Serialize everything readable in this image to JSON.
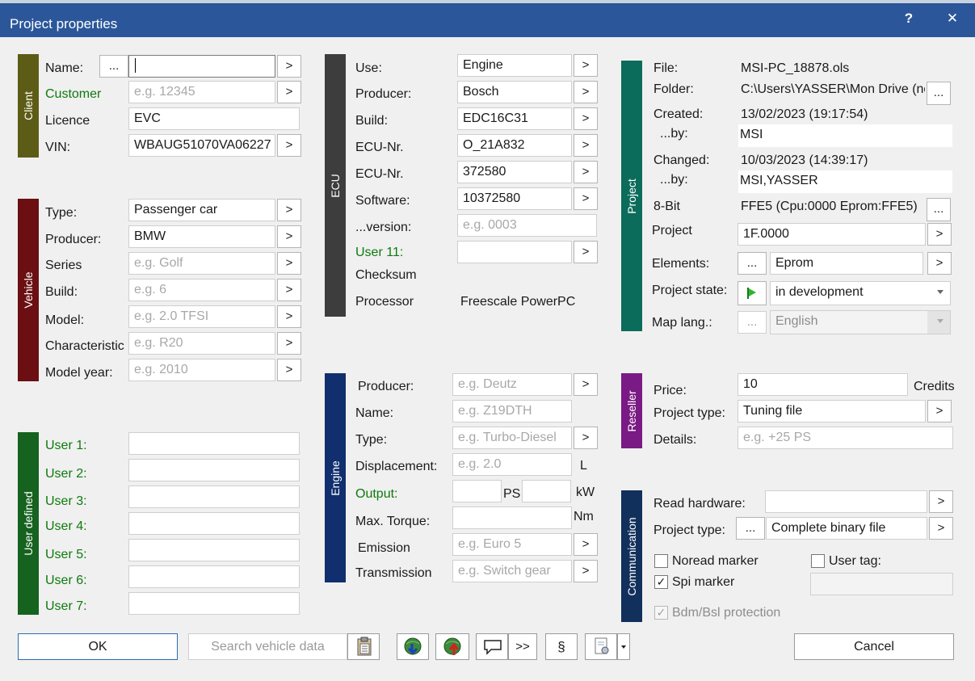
{
  "window": {
    "title": "Project properties",
    "help": "?",
    "close": "✕"
  },
  "common": {
    "more": "...",
    "next": ">"
  },
  "client": {
    "section": "Client",
    "name_label": "Name:",
    "name_value": "",
    "customer_label": "Customer",
    "customer_placeholder": "e.g. 12345",
    "licence_label": "Licence",
    "licence_value": "EVC",
    "vin_label": "VIN:",
    "vin_value": "WBAUG51070VA06227"
  },
  "vehicle": {
    "section": "Vehicle",
    "type_label": "Type:",
    "type_value": "Passenger car",
    "producer_label": "Producer:",
    "producer_value": "BMW",
    "series_label": "Series",
    "series_placeholder": "e.g. Golf",
    "build_label": "Build:",
    "build_placeholder": "e.g. 6",
    "model_label": "Model:",
    "model_placeholder": "e.g. 2.0 TFSI",
    "char_label": "Characteristic",
    "char_placeholder": "e.g. R20",
    "year_label": "Model year:",
    "year_placeholder": "e.g. 2010"
  },
  "user_defined": {
    "section": "User defined",
    "labels": [
      "User 1:",
      "User 2:",
      "User 3:",
      "User 4:",
      "User 5:",
      "User 6:",
      "User 7:"
    ]
  },
  "ecu": {
    "section": "ECU",
    "use_label": "Use:",
    "use_value": "Engine",
    "producer_label": "Producer:",
    "producer_value": "Bosch",
    "build_label": "Build:",
    "build_value": "EDC16C31",
    "ecunr1_label": "ECU-Nr.",
    "ecunr1_value": "O_21A832",
    "ecunr2_label": "ECU-Nr.",
    "ecunr2_value": "372580",
    "software_label": "Software:",
    "software_value": "10372580",
    "version_label": "...version:",
    "version_placeholder": "e.g. 0003",
    "user11_label": "User 11:",
    "user11_value": "",
    "checksum_label": "Checksum",
    "processor_label": "Processor",
    "processor_value": "Freescale PowerPC"
  },
  "engine": {
    "section": "Engine",
    "producer_label": "Producer:",
    "producer_placeholder": "e.g. Deutz",
    "name_label": "Name:",
    "name_placeholder": "e.g. Z19DTH",
    "type_label": "Type:",
    "type_placeholder": "e.g. Turbo-Diesel",
    "displacement_label": "Displacement:",
    "displacement_placeholder": "e.g. 2.0",
    "displacement_unit": "L",
    "output_label": "Output:",
    "ps_unit": "PS",
    "kw_unit": "kW",
    "torque_label": "Max. Torque:",
    "torque_unit": "Nm",
    "emission_label": "Emission",
    "emission_placeholder": "e.g. Euro 5",
    "transmission_label": "Transmission",
    "transmission_placeholder": "e.g. Switch gear"
  },
  "project": {
    "section": "Project",
    "file_label": "File:",
    "file_value": "MSI-PC_18878.ols",
    "folder_label": "Folder:",
    "folder_value": "C:\\Users\\YASSER\\Mon Drive (no",
    "created_label": "Created:",
    "created_value": "13/02/2023 (19:17:54)",
    "by1_label": "...by:",
    "by1_value": "MSI",
    "changed_label": "Changed:",
    "changed_value": "10/03/2023 (14:39:17)",
    "by2_label": "...by:",
    "by2_value": "MSI,YASSER",
    "bit_label": "8-Bit",
    "bit_value": "FFE5 (Cpu:0000 Eprom:FFE5)",
    "project_label": "Project",
    "project_value": "1F.0000",
    "elements_label": "Elements:",
    "elements_value": "Eprom",
    "state_label": "Project state:",
    "state_value": "in development",
    "maplang_label": "Map lang.:",
    "maplang_value": "English"
  },
  "reseller": {
    "section": "Reseller",
    "price_label": "Price:",
    "price_value": "10",
    "credits": "Credits",
    "ptype_label": "Project type:",
    "ptype_value": "Tuning file",
    "details_label": "Details:",
    "details_placeholder": "e.g. +25 PS"
  },
  "communication": {
    "section": "Communication",
    "read_label": "Read hardware:",
    "read_value": "",
    "ptype_label": "Project type:",
    "ptype_value": "Complete binary file",
    "noread_label": "Noread marker",
    "spi_label": "Spi marker",
    "usertag_label": "User tag:",
    "bdm_label": "Bdm/Bsl protection",
    "noread_checked": false,
    "spi_checked": true,
    "usertag_checked": false,
    "bdm_checked": true
  },
  "buttons": {
    "ok": "OK",
    "search": "Search vehicle data",
    "expand": ">>",
    "paragraph": "§",
    "cancel": "Cancel"
  },
  "colors": {
    "title_bar": "#2b579a",
    "client": "#5c5c16",
    "vehicle": "#6b0f12",
    "user_defined": "#16621f",
    "ecu": "#3d3d3d",
    "engine": "#112f6e",
    "project": "#0b6c5b",
    "reseller": "#7a1a84",
    "communication": "#11305c"
  }
}
